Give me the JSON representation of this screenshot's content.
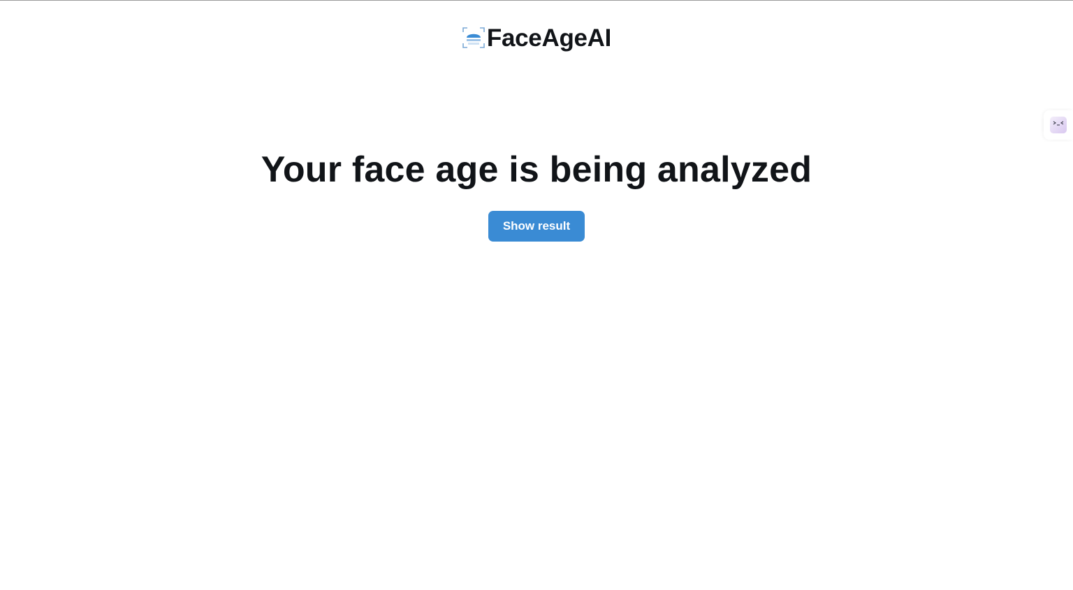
{
  "header": {
    "brand_name": "FaceAgeAI",
    "logo_icon": "face-scan-icon"
  },
  "main": {
    "headline": "Your face age is being analyzed",
    "show_result_label": "Show result"
  },
  "side_widget": {
    "icon": "assistant-face-icon"
  },
  "colors": {
    "accent": "#3a8bd4",
    "text": "#111418",
    "background": "#ffffff"
  }
}
